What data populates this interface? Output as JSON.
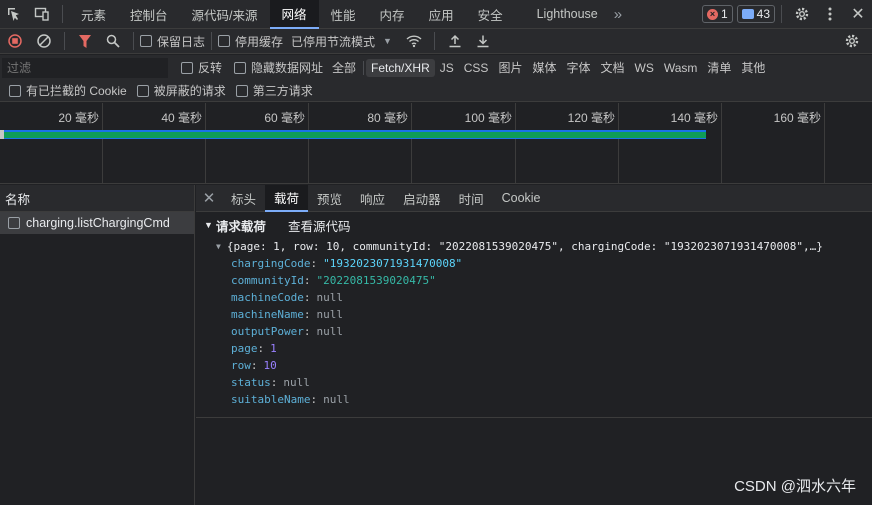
{
  "tabs": {
    "items": [
      "元素",
      "控制台",
      "源代码/来源",
      "网络",
      "性能",
      "内存",
      "应用",
      "安全",
      "Lighthouse"
    ],
    "more": "»",
    "error_count": "1",
    "message_count": "43"
  },
  "toolbar": {
    "preserve_log": "保留日志",
    "disable_cache": "停用缓存",
    "throttling": "已停用节流模式"
  },
  "filter": {
    "placeholder": "过滤",
    "invert": "反转",
    "hide_data_urls": "隐藏数据网址",
    "types": [
      "全部",
      "Fetch/XHR",
      "JS",
      "CSS",
      "图片",
      "媒体",
      "字体",
      "文档",
      "WS",
      "Wasm",
      "清单",
      "其他"
    ],
    "active_type": "Fetch/XHR",
    "blocked_cookies": "有已拦截的 Cookie",
    "blocked_requests": "被屏蔽的请求",
    "third_party": "第三方请求"
  },
  "timeline": {
    "ticks": [
      "20 毫秒",
      "40 毫秒",
      "60 毫秒",
      "80 毫秒",
      "100 毫秒",
      "120 毫秒",
      "140 毫秒",
      "160 毫秒"
    ],
    "bar_end_ms": 137
  },
  "requests": {
    "header": "名称",
    "items": [
      "charging.listChargingCmd"
    ]
  },
  "detail": {
    "tabs": [
      "标头",
      "载荷",
      "预览",
      "响应",
      "启动器",
      "时间",
      "Cookie"
    ],
    "active_tab": "载荷",
    "payload_title": "请求载荷",
    "view_source": "查看源代码",
    "summary": "{page: 1, row: 10, communityId: \"2022081539020475\", chargingCode: \"1932023071931470008\",…}",
    "props": [
      {
        "key": "chargingCode",
        "value": "\"1932023071931470008\"",
        "kind": "str"
      },
      {
        "key": "communityId",
        "value": "\"2022081539020475\"",
        "kind": "str2"
      },
      {
        "key": "machineCode",
        "value": "null",
        "kind": "null"
      },
      {
        "key": "machineName",
        "value": "null",
        "kind": "null"
      },
      {
        "key": "outputPower",
        "value": "null",
        "kind": "null"
      },
      {
        "key": "page",
        "value": "1",
        "kind": "num"
      },
      {
        "key": "row",
        "value": "10",
        "kind": "num"
      },
      {
        "key": "status",
        "value": "null",
        "kind": "null"
      },
      {
        "key": "suitableName",
        "value": "null",
        "kind": "null"
      }
    ]
  },
  "watermark": "CSDN @泗水六年",
  "colors": {
    "accent": "#7cacf8",
    "record": "#e46962",
    "filter_active": "#e46962",
    "bar_green": "#0f9d58"
  }
}
